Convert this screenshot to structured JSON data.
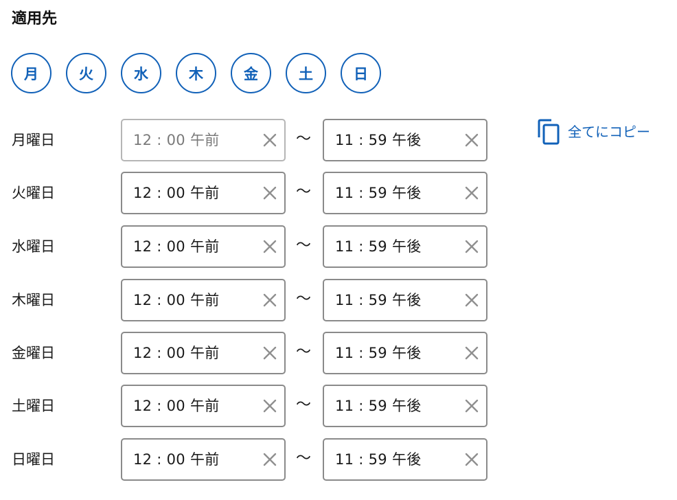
{
  "section": {
    "title": "適用先"
  },
  "day_buttons": [
    "月",
    "火",
    "水",
    "木",
    "金",
    "土",
    "日"
  ],
  "copy_all": {
    "label": "全てにコピー",
    "icon": "copy-icon"
  },
  "range_separator": "〜",
  "rows": [
    {
      "label": "月曜日",
      "start": "12 : 00 午前",
      "end": "11 : 59 午後"
    },
    {
      "label": "火曜日",
      "start": "12 : 00 午前",
      "end": "11 : 59 午後"
    },
    {
      "label": "水曜日",
      "start": "12 : 00 午前",
      "end": "11 : 59 午後"
    },
    {
      "label": "木曜日",
      "start": "12 : 00 午前",
      "end": "11 : 59 午後"
    },
    {
      "label": "金曜日",
      "start": "12 : 00 午前",
      "end": "11 : 59 午後"
    },
    {
      "label": "土曜日",
      "start": "12 : 00 午前",
      "end": "11 : 59 午後"
    },
    {
      "label": "日曜日",
      "start": "12 : 00 午前",
      "end": "11 : 59 午後"
    }
  ],
  "colors": {
    "accent": "#1161b8",
    "field_border": "#8a8a8a",
    "field_border_muted": "#b5b5b5",
    "clear_icon": "#8f8f8f"
  }
}
